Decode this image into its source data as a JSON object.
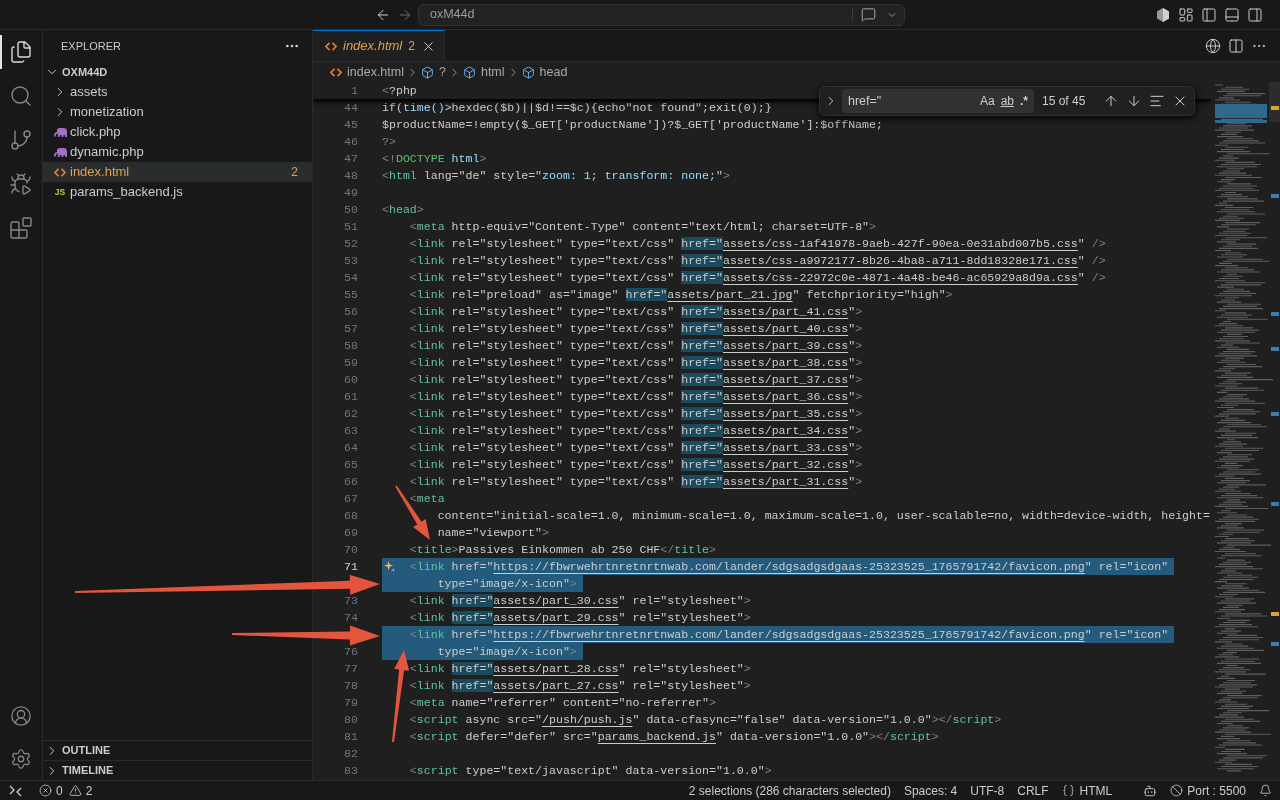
{
  "title_bar": {
    "command_center": "oxM44d"
  },
  "activity_bar": {
    "top": [
      {
        "kind": "explorer",
        "selected": true
      },
      {
        "kind": "search",
        "selected": false
      },
      {
        "kind": "source_control",
        "selected": false
      },
      {
        "kind": "run_debug",
        "selected": false
      },
      {
        "kind": "extensions",
        "selected": false
      }
    ],
    "bottom": [
      {
        "kind": "account"
      },
      {
        "kind": "settings"
      }
    ]
  },
  "sidebar": {
    "title": "EXPLORER",
    "tree": [
      {
        "kind": "folder",
        "label": "OXM44D",
        "expanded": true,
        "selected": false,
        "children": [
          {
            "kind": "folder",
            "label": "assets",
            "expanded": false,
            "selected": false
          },
          {
            "kind": "folder",
            "label": "monetization",
            "expanded": false,
            "selected": false
          },
          {
            "kind": "php",
            "label": "click.php",
            "selected": false
          },
          {
            "kind": "php",
            "label": "dynamic.php",
            "selected": false
          },
          {
            "kind": "html",
            "label": "index.html",
            "selected": true,
            "problems": "2"
          },
          {
            "kind": "js",
            "label": "params_backend.js",
            "icon_text": "JS",
            "selected": false
          }
        ]
      }
    ],
    "sections": [
      {
        "label": "OUTLINE",
        "expanded": false
      },
      {
        "label": "TIMELINE",
        "expanded": false
      }
    ]
  },
  "editor": {
    "tabs": [
      {
        "kind": "html",
        "label": "index.html",
        "problems": "2",
        "selected": true,
        "preview": true
      }
    ],
    "breadcrumbs": [
      {
        "kind": "html",
        "label": "index.html"
      },
      {
        "kind": "element",
        "label": "?"
      },
      {
        "kind": "element",
        "label": "html"
      },
      {
        "kind": "element",
        "label": "head"
      }
    ],
    "find_widget": {
      "value": "href=\"",
      "match_case": "Aa",
      "whole_word": "ab",
      "regex": ".*",
      "count": "15 of 45"
    },
    "sticky_lines": [
      {
        "number": "1",
        "current": false,
        "segments": [
          {
            "kind": "punct",
            "text": "<"
          },
          {
            "kind": "text",
            "text": "?php"
          }
        ]
      }
    ],
    "lines": [
      {
        "number": "44",
        "selected": false,
        "current": false,
        "sparkle": false,
        "segments": [
          {
            "kind": "text",
            "text": "if("
          },
          {
            "kind": "fn",
            "text": "time()"
          },
          {
            "kind": "text",
            "text": ">hexdec($b)||$d!==$c){echo\"not found\";exit(0);}"
          }
        ]
      },
      {
        "number": "45",
        "selected": false,
        "current": false,
        "sparkle": false,
        "segments": [
          {
            "kind": "text",
            "text": "$productName=!empty($_GET['productName'])?$_GET['productName']:$offName;"
          }
        ]
      },
      {
        "number": "46",
        "selected": false,
        "current": false,
        "sparkle": false,
        "segments": [
          {
            "kind": "punct",
            "text": "?>"
          }
        ]
      },
      {
        "number": "47",
        "selected": false,
        "current": false,
        "sparkle": false,
        "segments": [
          {
            "kind": "punct",
            "text": "<!"
          },
          {
            "kind": "keyword",
            "text": "DOCTYPE"
          },
          {
            "kind": "attr",
            "text": " html"
          },
          {
            "kind": "punct",
            "text": ">"
          }
        ]
      },
      {
        "number": "48",
        "selected": false,
        "current": false,
        "sparkle": false,
        "segments": [
          {
            "kind": "punct",
            "text": "<"
          },
          {
            "kind": "tag",
            "text": "html"
          },
          {
            "kind": "text",
            "text": " lang=\"de\" style=\""
          },
          {
            "kind": "attr",
            "text": "zoom: 1; transform: none;"
          },
          {
            "kind": "text",
            "text": "\""
          },
          {
            "kind": "punct",
            "text": ">"
          }
        ]
      },
      {
        "number": "49",
        "selected": false,
        "current": false,
        "sparkle": false
      },
      {
        "number": "50",
        "selected": false,
        "current": false,
        "sparkle": false,
        "segments": [
          {
            "kind": "punct",
            "text": "<"
          },
          {
            "kind": "tag",
            "text": "head"
          },
          {
            "kind": "punct",
            "text": ">"
          }
        ]
      },
      {
        "number": "51",
        "selected": false,
        "current": false,
        "sparkle": false,
        "segments": [
          {
            "kind": "punct",
            "text": "    <"
          },
          {
            "kind": "tag",
            "text": "meta"
          },
          {
            "kind": "text",
            "text": " http-equiv=\"Content-Type\" content=\"text/html; charset=UTF-8\""
          },
          {
            "kind": "punct",
            "text": ">"
          }
        ]
      },
      {
        "number": "52",
        "selected": false,
        "current": false,
        "sparkle": false,
        "segments": [
          {
            "kind": "punct",
            "text": "    <"
          },
          {
            "kind": "tag",
            "text": "link"
          },
          {
            "kind": "text",
            "text": " rel=\"stylesheet\" type=\"text/css\" "
          },
          {
            "kind": "match",
            "text": "href=\""
          },
          {
            "kind": "url",
            "text": "assets/css-1af41978-9aeb-427f-90ea-0e31abd007b5.css"
          },
          {
            "kind": "text",
            "text": "\" "
          },
          {
            "kind": "punct",
            "text": "/>"
          }
        ]
      },
      {
        "number": "53",
        "selected": false,
        "current": false,
        "sparkle": false,
        "segments": [
          {
            "kind": "punct",
            "text": "    <"
          },
          {
            "kind": "tag",
            "text": "link"
          },
          {
            "kind": "text",
            "text": " rel=\"stylesheet\" type=\"text/css\" "
          },
          {
            "kind": "match",
            "text": "href=\""
          },
          {
            "kind": "url",
            "text": "assets/css-a9972177-8b26-4ba8-a711-8dd18328e171.css"
          },
          {
            "kind": "text",
            "text": "\" "
          },
          {
            "kind": "punct",
            "text": "/>"
          }
        ]
      },
      {
        "number": "54",
        "selected": false,
        "current": false,
        "sparkle": false,
        "segments": [
          {
            "kind": "punct",
            "text": "    <"
          },
          {
            "kind": "tag",
            "text": "link"
          },
          {
            "kind": "text",
            "text": " rel=\"stylesheet\" type=\"text/css\" "
          },
          {
            "kind": "match",
            "text": "href=\""
          },
          {
            "kind": "url",
            "text": "assets/css-22972c0e-4871-4a48-be46-ac65929a8d9a.css"
          },
          {
            "kind": "text",
            "text": "\" "
          },
          {
            "kind": "punct",
            "text": "/>"
          }
        ]
      },
      {
        "number": "55",
        "selected": false,
        "current": false,
        "sparkle": false,
        "segments": [
          {
            "kind": "punct",
            "text": "    <"
          },
          {
            "kind": "tag",
            "text": "link"
          },
          {
            "kind": "text",
            "text": " rel=\"preload\" as=\"image\" "
          },
          {
            "kind": "match",
            "text": "href=\""
          },
          {
            "kind": "url",
            "text": "assets/part_21.jpg"
          },
          {
            "kind": "text",
            "text": "\" fetchpriority=\"high\""
          },
          {
            "kind": "punct",
            "text": ">"
          }
        ]
      },
      {
        "number": "56",
        "selected": false,
        "current": false,
        "sparkle": false,
        "segments": [
          {
            "kind": "punct",
            "text": "    <"
          },
          {
            "kind": "tag",
            "text": "link"
          },
          {
            "kind": "text",
            "text": " rel=\"stylesheet\" type=\"text/css\" "
          },
          {
            "kind": "match",
            "text": "href=\""
          },
          {
            "kind": "url",
            "text": "assets/part_41.css"
          },
          {
            "kind": "text",
            "text": "\""
          },
          {
            "kind": "punct",
            "text": ">"
          }
        ]
      },
      {
        "number": "57",
        "selected": false,
        "current": false,
        "sparkle": false,
        "segments": [
          {
            "kind": "punct",
            "text": "    <"
          },
          {
            "kind": "tag",
            "text": "link"
          },
          {
            "kind": "text",
            "text": " rel=\"stylesheet\" type=\"text/css\" "
          },
          {
            "kind": "match",
            "text": "href=\""
          },
          {
            "kind": "url",
            "text": "assets/part_40.css"
          },
          {
            "kind": "text",
            "text": "\""
          },
          {
            "kind": "punct",
            "text": ">"
          }
        ]
      },
      {
        "number": "58",
        "selected": false,
        "current": false,
        "sparkle": false,
        "segments": [
          {
            "kind": "punct",
            "text": "    <"
          },
          {
            "kind": "tag",
            "text": "link"
          },
          {
            "kind": "text",
            "text": " rel=\"stylesheet\" type=\"text/css\" "
          },
          {
            "kind": "match",
            "text": "href=\""
          },
          {
            "kind": "url",
            "text": "assets/part_39.css"
          },
          {
            "kind": "text",
            "text": "\""
          },
          {
            "kind": "punct",
            "text": ">"
          }
        ]
      },
      {
        "number": "59",
        "selected": false,
        "current": false,
        "sparkle": false,
        "segments": [
          {
            "kind": "punct",
            "text": "    <"
          },
          {
            "kind": "tag",
            "text": "link"
          },
          {
            "kind": "text",
            "text": " rel=\"stylesheet\" type=\"text/css\" "
          },
          {
            "kind": "match",
            "text": "href=\""
          },
          {
            "kind": "url",
            "text": "assets/part_38.css"
          },
          {
            "kind": "text",
            "text": "\""
          },
          {
            "kind": "punct",
            "text": ">"
          }
        ]
      },
      {
        "number": "60",
        "selected": false,
        "current": false,
        "sparkle": false,
        "segments": [
          {
            "kind": "punct",
            "text": "    <"
          },
          {
            "kind": "tag",
            "text": "link"
          },
          {
            "kind": "text",
            "text": " rel=\"stylesheet\" type=\"text/css\" "
          },
          {
            "kind": "match",
            "text": "href=\""
          },
          {
            "kind": "url",
            "text": "assets/part_37.css"
          },
          {
            "kind": "text",
            "text": "\""
          },
          {
            "kind": "punct",
            "text": ">"
          }
        ]
      },
      {
        "number": "61",
        "selected": false,
        "current": false,
        "sparkle": false,
        "segments": [
          {
            "kind": "punct",
            "text": "    <"
          },
          {
            "kind": "tag",
            "text": "link"
          },
          {
            "kind": "text",
            "text": " rel=\"stylesheet\" type=\"text/css\" "
          },
          {
            "kind": "match",
            "text": "href=\""
          },
          {
            "kind": "url",
            "text": "assets/part_36.css"
          },
          {
            "kind": "text",
            "text": "\""
          },
          {
            "kind": "punct",
            "text": ">"
          }
        ]
      },
      {
        "number": "62",
        "selected": false,
        "current": false,
        "sparkle": false,
        "segments": [
          {
            "kind": "punct",
            "text": "    <"
          },
          {
            "kind": "tag",
            "text": "link"
          },
          {
            "kind": "text",
            "text": " rel=\"stylesheet\" type=\"text/css\" "
          },
          {
            "kind": "match",
            "text": "href=\""
          },
          {
            "kind": "url",
            "text": "assets/part_35.css"
          },
          {
            "kind": "text",
            "text": "\""
          },
          {
            "kind": "punct",
            "text": ">"
          }
        ]
      },
      {
        "number": "63",
        "selected": false,
        "current": false,
        "sparkle": false,
        "segments": [
          {
            "kind": "punct",
            "text": "    <"
          },
          {
            "kind": "tag",
            "text": "link"
          },
          {
            "kind": "text",
            "text": " rel=\"stylesheet\" type=\"text/css\" "
          },
          {
            "kind": "match",
            "text": "href=\""
          },
          {
            "kind": "url",
            "text": "assets/part_34.css"
          },
          {
            "kind": "text",
            "text": "\""
          },
          {
            "kind": "punct",
            "text": ">"
          }
        ]
      },
      {
        "number": "64",
        "selected": false,
        "current": false,
        "sparkle": false,
        "segments": [
          {
            "kind": "punct",
            "text": "    <"
          },
          {
            "kind": "tag",
            "text": "link"
          },
          {
            "kind": "text",
            "text": " rel=\"stylesheet\" type=\"text/css\" "
          },
          {
            "kind": "match",
            "text": "href=\""
          },
          {
            "kind": "url",
            "text": "assets/part_33.css"
          },
          {
            "kind": "text",
            "text": "\""
          },
          {
            "kind": "punct",
            "text": ">"
          }
        ]
      },
      {
        "number": "65",
        "selected": false,
        "current": false,
        "sparkle": false,
        "segments": [
          {
            "kind": "punct",
            "text": "    <"
          },
          {
            "kind": "tag",
            "text": "link"
          },
          {
            "kind": "text",
            "text": " rel=\"stylesheet\" type=\"text/css\" "
          },
          {
            "kind": "match",
            "text": "href=\""
          },
          {
            "kind": "url",
            "text": "assets/part_32.css"
          },
          {
            "kind": "text",
            "text": "\""
          },
          {
            "kind": "punct",
            "text": ">"
          }
        ]
      },
      {
        "number": "66",
        "selected": false,
        "current": false,
        "sparkle": false,
        "segments": [
          {
            "kind": "punct",
            "text": "    <"
          },
          {
            "kind": "tag",
            "text": "link"
          },
          {
            "kind": "text",
            "text": " rel=\"stylesheet\" type=\"text/css\" "
          },
          {
            "kind": "match",
            "text": "href=\""
          },
          {
            "kind": "url",
            "text": "assets/part_31.css"
          },
          {
            "kind": "text",
            "text": "\""
          },
          {
            "kind": "punct",
            "text": ">"
          }
        ]
      },
      {
        "number": "67",
        "selected": false,
        "current": false,
        "sparkle": false,
        "segments": [
          {
            "kind": "punct",
            "text": "    <"
          },
          {
            "kind": "tag",
            "text": "meta"
          }
        ]
      },
      {
        "number": "68",
        "selected": false,
        "current": false,
        "sparkle": false,
        "segments": [
          {
            "kind": "text",
            "text": "        content=\"initial-scale=1.0, minimum-scale=1.0, maximum-scale=1.0, user-scalable=no, width=device-width, height="
          }
        ]
      },
      {
        "number": "69",
        "selected": false,
        "current": false,
        "sparkle": false,
        "segments": [
          {
            "kind": "text",
            "text": "        name=\"viewport\""
          },
          {
            "kind": "punct",
            "text": ">"
          }
        ]
      },
      {
        "number": "70",
        "selected": false,
        "current": false,
        "sparkle": false,
        "segments": [
          {
            "kind": "punct",
            "text": "    <"
          },
          {
            "kind": "tag",
            "text": "title"
          },
          {
            "kind": "punct",
            "text": ">"
          },
          {
            "kind": "text",
            "text": "Passives Einkommen ab 250 CHF"
          },
          {
            "kind": "punct",
            "text": "</"
          },
          {
            "kind": "tag",
            "text": "title"
          },
          {
            "kind": "punct",
            "text": ">"
          }
        ]
      },
      {
        "number": "71",
        "selected": true,
        "current": true,
        "sparkle": true,
        "segments": [
          {
            "kind": "punct",
            "text": "    <"
          },
          {
            "kind": "tag",
            "text": "link"
          },
          {
            "kind": "text",
            "text": " href=\""
          },
          {
            "kind": "url",
            "text": "https://fbwrwehrtnretnrtnwab.com/lander/sdgsadgsdgaas-25323525_1765791742/favicon.png"
          },
          {
            "kind": "text",
            "text": "\" rel=\"icon\""
          }
        ]
      },
      {
        "selected": true,
        "sparkle": false,
        "segments": [
          {
            "kind": "text",
            "text": "        type=\"image/x-icon\""
          },
          {
            "kind": "punct",
            "text": ">"
          }
        ]
      },
      {
        "number": "73",
        "selected": false,
        "current": false,
        "sparkle": false,
        "segments": [
          {
            "kind": "punct",
            "text": "    <"
          },
          {
            "kind": "tag",
            "text": "link "
          },
          {
            "kind": "match",
            "text": "href=\""
          },
          {
            "kind": "url",
            "text": "assets/part_30.css"
          },
          {
            "kind": "text",
            "text": "\" rel=\"stylesheet\""
          },
          {
            "kind": "punct",
            "text": ">"
          }
        ]
      },
      {
        "number": "74",
        "selected": false,
        "current": false,
        "sparkle": false,
        "segments": [
          {
            "kind": "punct",
            "text": "    <"
          },
          {
            "kind": "tag",
            "text": "link "
          },
          {
            "kind": "match",
            "text": "href=\""
          },
          {
            "kind": "url",
            "text": "assets/part_29.css"
          },
          {
            "kind": "text",
            "text": "\" rel=\"stylesheet\""
          },
          {
            "kind": "punct",
            "text": ">"
          }
        ]
      },
      {
        "selected": true,
        "sparkle": false,
        "segments": [
          {
            "kind": "punct",
            "text": "    <"
          },
          {
            "kind": "tag",
            "text": "link"
          },
          {
            "kind": "text",
            "text": " href=\""
          },
          {
            "kind": "url",
            "text": "https://fbwrwehrtnretnrtnwab.com/lander/sdgsadgsdgaas-25323525_1765791742/favicon.png"
          },
          {
            "kind": "text",
            "text": "\" rel=\"icon\""
          }
        ]
      },
      {
        "number": "76",
        "selected": true,
        "current": false,
        "sparkle": false,
        "segments": [
          {
            "kind": "text",
            "text": "        type=\"image/x-icon\""
          },
          {
            "kind": "punct",
            "text": ">"
          }
        ]
      },
      {
        "number": "77",
        "selected": false,
        "current": false,
        "sparkle": false,
        "segments": [
          {
            "kind": "punct",
            "text": "    <"
          },
          {
            "kind": "tag",
            "text": "link "
          },
          {
            "kind": "match",
            "text": "href=\""
          },
          {
            "kind": "url",
            "text": "assets/part_28.css"
          },
          {
            "kind": "text",
            "text": "\" rel=\"stylesheet\""
          },
          {
            "kind": "punct",
            "text": ">"
          }
        ]
      },
      {
        "number": "78",
        "selected": false,
        "current": false,
        "sparkle": false,
        "segments": [
          {
            "kind": "punct",
            "text": "    <"
          },
          {
            "kind": "tag",
            "text": "link "
          },
          {
            "kind": "match",
            "text": "href=\""
          },
          {
            "kind": "url",
            "text": "assets/part_27.css"
          },
          {
            "kind": "text",
            "text": "\" rel=\"stylesheet\""
          },
          {
            "kind": "punct",
            "text": ">"
          }
        ]
      },
      {
        "number": "79",
        "selected": false,
        "current": false,
        "sparkle": false,
        "segments": [
          {
            "kind": "punct",
            "text": "    <"
          },
          {
            "kind": "tag",
            "text": "meta"
          },
          {
            "kind": "text",
            "text": " name=\"referrer\" content=\"no-referrer\""
          },
          {
            "kind": "punct",
            "text": ">"
          }
        ]
      },
      {
        "number": "80",
        "selected": false,
        "current": false,
        "sparkle": false,
        "segments": [
          {
            "kind": "punct",
            "text": "    <"
          },
          {
            "kind": "tag",
            "text": "script"
          },
          {
            "kind": "text",
            "text": " async src=\""
          },
          {
            "kind": "url",
            "text": "/push/push.js"
          },
          {
            "kind": "text",
            "text": "\" data-cfasync=\"false\" data-version=\"1.0.0\""
          },
          {
            "kind": "punct",
            "text": "></"
          },
          {
            "kind": "tag",
            "text": "script"
          },
          {
            "kind": "punct",
            "text": ">"
          }
        ]
      },
      {
        "number": "81",
        "selected": false,
        "current": false,
        "sparkle": false,
        "segments": [
          {
            "kind": "punct",
            "text": "    <"
          },
          {
            "kind": "tag",
            "text": "script"
          },
          {
            "kind": "text",
            "text": " defer=\"defer\" src=\""
          },
          {
            "kind": "url",
            "text": "params_backend.js"
          },
          {
            "kind": "text",
            "text": "\" data-version=\"1.0.0\""
          },
          {
            "kind": "punct",
            "text": "></"
          },
          {
            "kind": "tag",
            "text": "script"
          },
          {
            "kind": "punct",
            "text": ">"
          }
        ]
      },
      {
        "number": "82",
        "selected": false,
        "current": false,
        "sparkle": false
      },
      {
        "number": "83",
        "selected": false,
        "current": false,
        "sparkle": false,
        "segments": [
          {
            "kind": "punct",
            "text": "    <"
          },
          {
            "kind": "tag",
            "text": "script"
          },
          {
            "kind": "text",
            "text": " type=\"text/javascript\" data-version=\"1.0.0\""
          },
          {
            "kind": "punct",
            "text": ">"
          }
        ]
      }
    ]
  },
  "status_bar": {
    "left": [
      {
        "kind": "remote"
      },
      {
        "kind": "problems",
        "errors": "0",
        "warnings": "2"
      }
    ],
    "right": [
      {
        "kind": "text",
        "label": "2 selections (286 characters selected)"
      },
      {
        "kind": "text",
        "label": "Spaces: 4"
      },
      {
        "kind": "text",
        "label": "UTF-8"
      },
      {
        "kind": "text",
        "label": "CRLF"
      },
      {
        "kind": "language",
        "label": "HTML"
      },
      {
        "kind": "copilot"
      },
      {
        "kind": "port",
        "label": "Port : 5500"
      },
      {
        "kind": "notifications"
      }
    ]
  }
}
